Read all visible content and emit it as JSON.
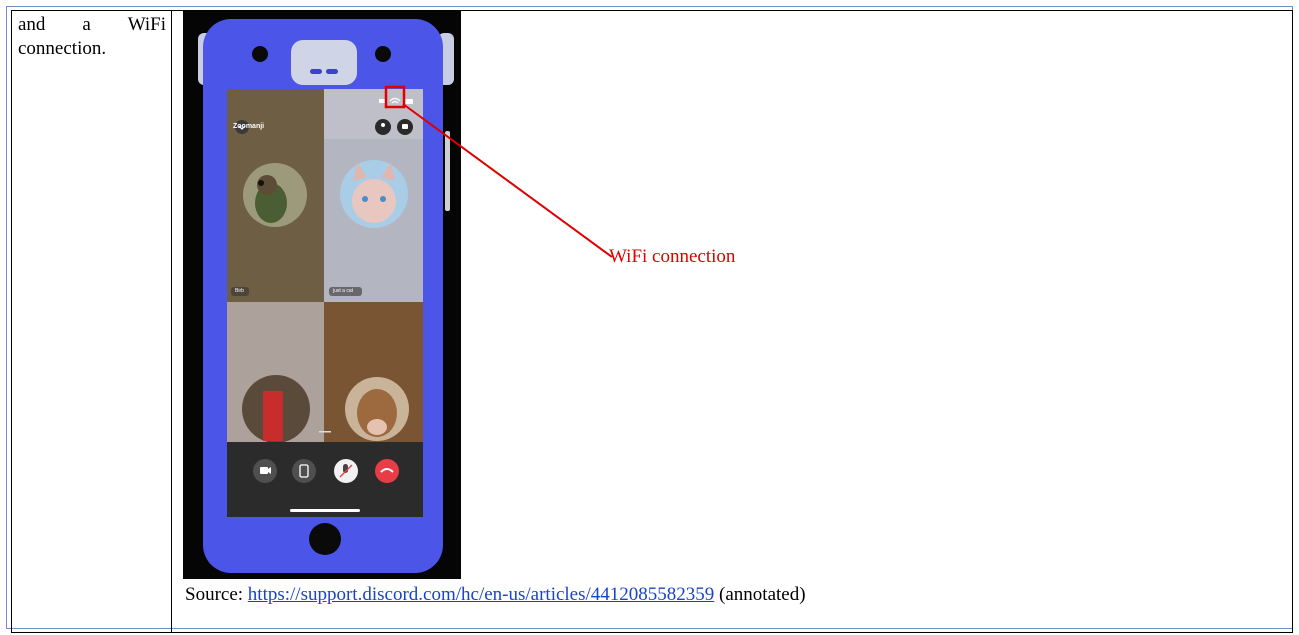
{
  "left_cell": {
    "line1": [
      "and",
      "a",
      "WiFi"
    ],
    "line2": "connection."
  },
  "phone": {
    "app_name": "Zoomanji",
    "tiles": [
      {
        "label": "Birb"
      },
      {
        "label": "just a cat"
      },
      {
        "label": ""
      },
      {
        "label": ""
      }
    ],
    "call_controls": [
      "camera-icon",
      "share-screen-icon",
      "mute-microphone-icon",
      "end-call-icon"
    ]
  },
  "annotation": {
    "label": "WiFi connection",
    "color": "#e00000"
  },
  "source": {
    "prefix": "Source: ",
    "url_text": "https://support.discord.com/hc/en-us/articles/4412085582359",
    "suffix": " (annotated)"
  },
  "colors": {
    "case": "#4b55e8",
    "link": "#1a44c8",
    "border": "#6d8fc4"
  }
}
